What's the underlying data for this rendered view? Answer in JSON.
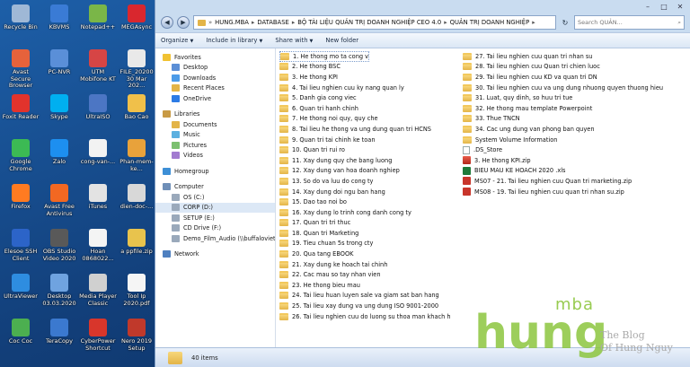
{
  "desktop": {
    "icons": [
      {
        "label": "Recycle Bin",
        "color": "#9fb8d6"
      },
      {
        "label": "KBVMS",
        "color": "#3a7bd5"
      },
      {
        "label": "Notepad++",
        "color": "#7ab648"
      },
      {
        "label": "MEGAsync",
        "color": "#d9272e"
      },
      {
        "label": "Avast Secure Browser",
        "color": "#e6623b"
      },
      {
        "label": "PC-NVR",
        "color": "#5a8fd8"
      },
      {
        "label": "UTM Mobifone KT",
        "color": "#d64545"
      },
      {
        "label": "FILE_20200 30 Mar 202...",
        "color": "#e9e9e9"
      },
      {
        "label": "Foxit Reader",
        "color": "#e2332c"
      },
      {
        "label": "Skype",
        "color": "#00aff0"
      },
      {
        "label": "UltraISO",
        "color": "#4c76c4"
      },
      {
        "label": "Bao Cao",
        "color": "#f0c04a"
      },
      {
        "label": "Google Chrome",
        "color": "#3cba54"
      },
      {
        "label": "Zalo",
        "color": "#1d8ff0"
      },
      {
        "label": "cong-van-...",
        "color": "#f2f2f2"
      },
      {
        "label": "Phan-mem-ke...",
        "color": "#e8a23b"
      },
      {
        "label": "Firefox",
        "color": "#ff7b21"
      },
      {
        "label": "Avast Free Antivirus",
        "color": "#f26822"
      },
      {
        "label": "iTunes",
        "color": "#e3e3e3"
      },
      {
        "label": "dien-doc-...",
        "color": "#d8d8d8"
      },
      {
        "label": "Elesoe SSH Client",
        "color": "#2c64c8"
      },
      {
        "label": "OBS Studio Video 2020",
        "color": "#595959"
      },
      {
        "label": "Hoan 0868022...",
        "color": "#f4f4f4"
      },
      {
        "label": "a ppfile.zip",
        "color": "#e8c34d"
      },
      {
        "label": "UltraViewer",
        "color": "#2e8de0"
      },
      {
        "label": "Desktop 03.03.2020",
        "color": "#6fa3e0"
      },
      {
        "label": "Media Player Classic",
        "color": "#d0d0d0"
      },
      {
        "label": "Tool Ip 2020.pdf",
        "color": "#f5f5f5"
      },
      {
        "label": "Coc Coc",
        "color": "#4caf50"
      },
      {
        "label": "TeraCopy",
        "color": "#3b79cf"
      },
      {
        "label": "CyberPower Shortcut",
        "color": "#d8362b"
      },
      {
        "label": "Nero 2019 Setup",
        "color": "#c0392b"
      }
    ]
  },
  "window": {
    "controls": {
      "minimize": "–",
      "maximize": "□",
      "close": "✕"
    },
    "address": [
      "HUNG.MBA",
      "DATABASE",
      "BỘ TÀI LIỆU QUẢN TRỊ DOANH NGHIỆP CEO 4.0",
      "QUẢN TRỊ DOANH NGHIỆP"
    ],
    "search_placeholder": "Search QUẢN...",
    "toolbar": {
      "organize": "Organize",
      "include": "Include in library",
      "share": "Share with",
      "new_folder": "New folder"
    },
    "nav": {
      "favorites": {
        "label": "Favorites",
        "items": [
          "Desktop",
          "Downloads",
          "Recent Places",
          "OneDrive"
        ]
      },
      "libraries": {
        "label": "Libraries",
        "items": [
          "Documents",
          "Music",
          "Pictures",
          "Videos"
        ]
      },
      "homegroup": "Homegroup",
      "computer": {
        "label": "Computer",
        "items": [
          "OS (C:)",
          "CORP (D:)",
          "SETUP (E:)",
          "CD Drive (F:)",
          "Demo_Film_Audio (\\\\buffaloviet"
        ]
      },
      "network": "Network"
    },
    "files_col1": [
      "1. He thong mo ta cong viec",
      "2. He thong BSC",
      "3. He thong KPI",
      "4. Tai lieu nghien cuu ky nang quan ly",
      "5. Danh gia cong viec",
      "6. Quan tri hanh chinh",
      "7. He thong noi quy, quy che",
      "8. Tai lieu he thong va ung dung quan tri HCNS",
      "9. Quan tri tai chinh ke toan",
      "10. Quan tri rui ro",
      "11. Xay dung quy che bang luong",
      "12. Xay dung van hoa doanh nghiep",
      "13. So do va luu do cong ty",
      "14. Xay dung doi ngu ban hang",
      "15. Dao tao noi bo",
      "16. Xay dung lo trinh cong danh cong ty",
      "17. Quan tri tri thuc",
      "18. Quan tri Marketing",
      "19. Tieu chuan 5s trong cty",
      "20. Qua tang EBOOK",
      "21. Xay dung ke hoach tai chinh",
      "22. Cac mau so tay nhan vien",
      "23. He thong bieu mau",
      "24. Tai lieu huan luyen sale va giam sat ban hang",
      "25. Tai lieu xay dung va ung dung ISO 9001-2000",
      "26. Tai lieu nghien cuu do luong su thoa man khach hang"
    ],
    "files_col2": [
      {
        "name": "27. Tai lieu nghien cuu quan tri nhan su",
        "type": "folder"
      },
      {
        "name": "28. Tai lieu nghien cuu Quan tri chien luoc",
        "type": "folder"
      },
      {
        "name": "29. Tai lieu nghien cuu KD va quan tri DN",
        "type": "folder"
      },
      {
        "name": "30. Tai lieu nghien cuu va ung dung nhuong quyen thuong hieu",
        "type": "folder"
      },
      {
        "name": "31. Luat, quy dinh, so huu tri tue",
        "type": "folder"
      },
      {
        "name": "32. He thong mau template Powerpoint",
        "type": "folder"
      },
      {
        "name": "33. Thue TNCN",
        "type": "folder"
      },
      {
        "name": "34. Cac ung dung van phong ban quyen",
        "type": "folder"
      },
      {
        "name": "System Volume Information",
        "type": "folder"
      },
      {
        "name": ".DS_Store",
        "type": "blank"
      },
      {
        "name": "3. He thong KPI.zip",
        "type": "zip"
      },
      {
        "name": "BIEU MAU KE HOACH 2020 .xls",
        "type": "xls"
      },
      {
        "name": "MS07 - 21. Tai lieu nghien cuu Quan tri marketing.zip",
        "type": "pdf"
      },
      {
        "name": "MS08 - 19. Tai lieu nghien cuu quan tri nhan su.zip",
        "type": "pdf"
      }
    ],
    "status": "40 items"
  },
  "watermark": {
    "mba": "mba",
    "hung": "hung",
    "line1": "The Blog",
    "line2": "Of Hung Nguy"
  }
}
